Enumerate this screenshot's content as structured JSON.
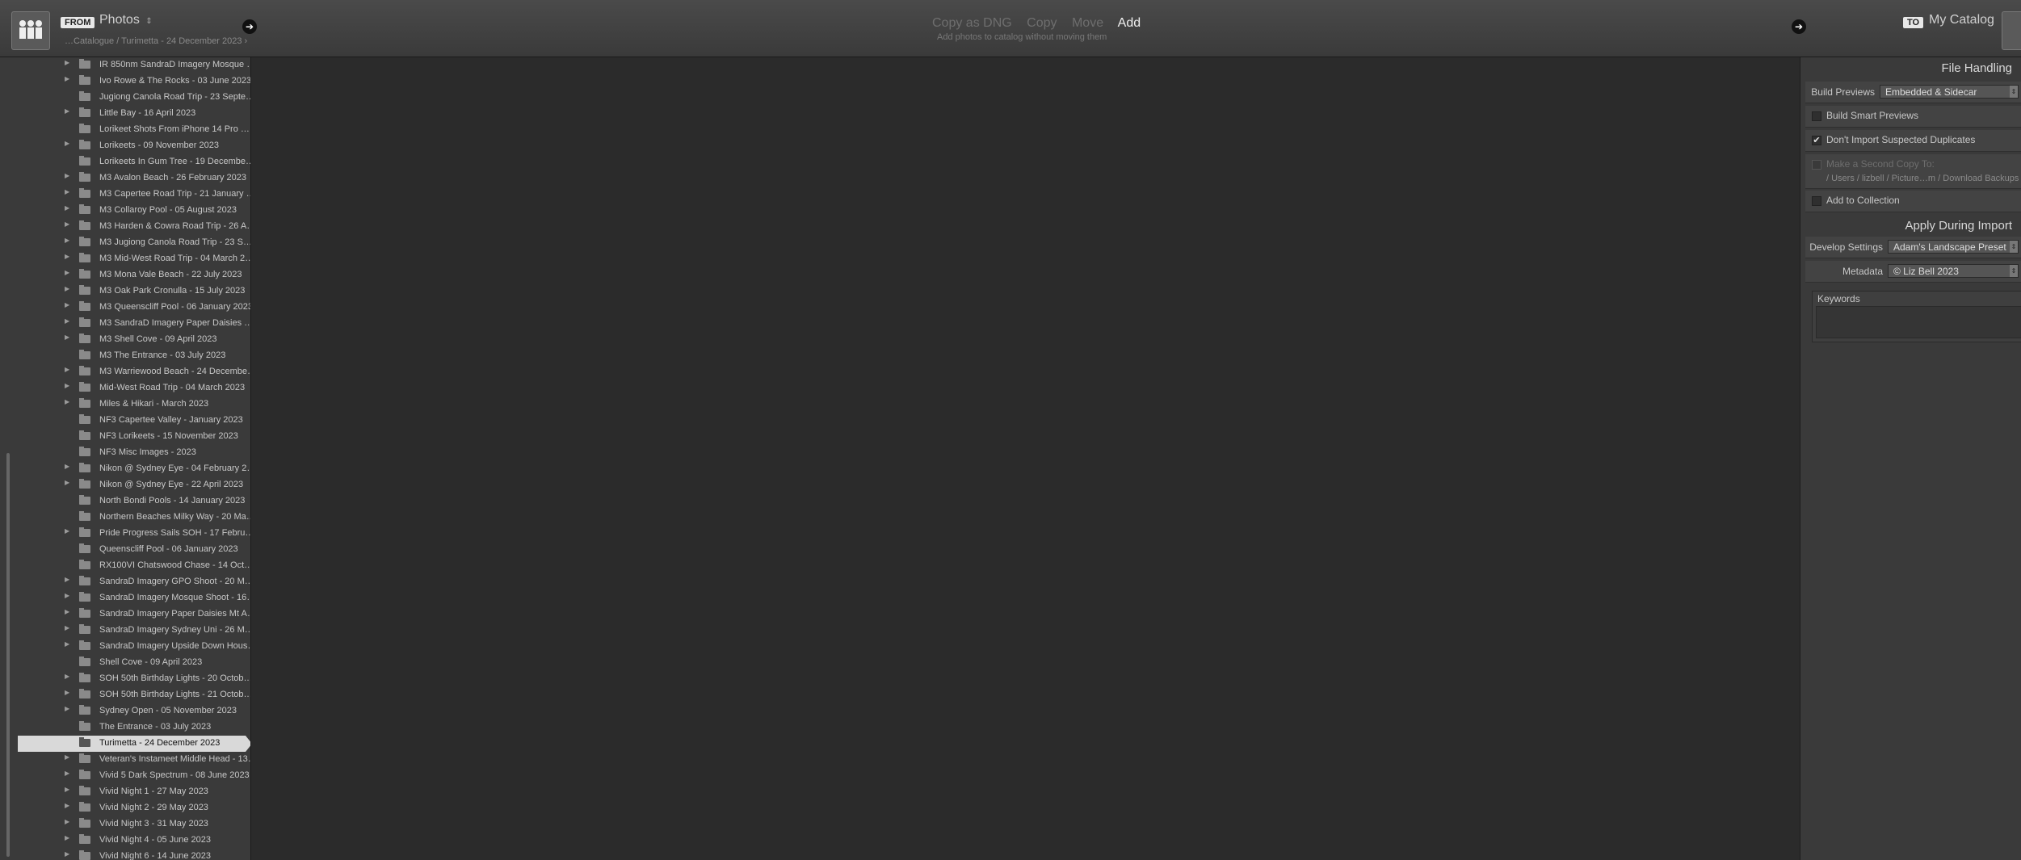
{
  "header": {
    "from_badge": "FROM",
    "source_name": "Photos",
    "source_chevron": "⇕",
    "source_path": "…Catalogue / Turimetta - 24 December 2023 ›",
    "modes": [
      "Copy as DNG",
      "Copy",
      "Move",
      "Add"
    ],
    "active_mode": "Add",
    "mode_description": "Add photos to catalog without moving them",
    "to_badge": "TO",
    "destination_name": "My Catalog",
    "arrow_glyph": "➔"
  },
  "folders": [
    {
      "label": "IR 850nm SandraD Imagery Mosque S…",
      "expandable": true,
      "selected": false
    },
    {
      "label": "Ivo Rowe & The Rocks - 03 June 2023",
      "expandable": true,
      "selected": false
    },
    {
      "label": "Jugiong Canola Road Trip - 23 Septemb…",
      "expandable": false,
      "selected": false
    },
    {
      "label": "Little Bay - 16 April 2023",
      "expandable": true,
      "selected": false
    },
    {
      "label": "Lorikeet Shots From iPhone 14 Pro Max…",
      "expandable": false,
      "selected": false
    },
    {
      "label": "Lorikeets - 09 November 2023",
      "expandable": true,
      "selected": false
    },
    {
      "label": "Lorikeets In Gum Tree - 19 December 2…",
      "expandable": false,
      "selected": false
    },
    {
      "label": "M3 Avalon Beach - 26 February 2023",
      "expandable": true,
      "selected": false
    },
    {
      "label": "M3 Capertee Road Trip - 21 January 2023",
      "expandable": true,
      "selected": false
    },
    {
      "label": "M3 Collaroy Pool - 05 August 2023",
      "expandable": true,
      "selected": false
    },
    {
      "label": "M3 Harden & Cowra Road Trip - 26 Aug…",
      "expandable": true,
      "selected": false
    },
    {
      "label": "M3 Jugiong Canola Road Trip - 23 Septe…",
      "expandable": true,
      "selected": false
    },
    {
      "label": "M3 Mid-West Road Trip - 04 March 2023",
      "expandable": true,
      "selected": false
    },
    {
      "label": "M3 Mona Vale Beach - 22 July 2023",
      "expandable": true,
      "selected": false
    },
    {
      "label": "M3 Oak Park Cronulla - 15 July 2023",
      "expandable": true,
      "selected": false
    },
    {
      "label": "M3 Queenscliff Pool - 06 January 2023",
      "expandable": true,
      "selected": false
    },
    {
      "label": "M3 SandraD Imagery Paper Daisies Mt…",
      "expandable": true,
      "selected": false
    },
    {
      "label": "M3 Shell Cove - 09 April 2023",
      "expandable": true,
      "selected": false
    },
    {
      "label": "M3 The Entrance - 03 July 2023",
      "expandable": false,
      "selected": false
    },
    {
      "label": "M3 Warriewood Beach - 24 December…",
      "expandable": true,
      "selected": false
    },
    {
      "label": "Mid-West Road Trip - 04 March 2023",
      "expandable": true,
      "selected": false
    },
    {
      "label": "Miles & Hikari - March 2023",
      "expandable": true,
      "selected": false
    },
    {
      "label": "NF3 Capertee Valley - January 2023",
      "expandable": false,
      "selected": false
    },
    {
      "label": "NF3 Lorikeets - 15 November 2023",
      "expandable": false,
      "selected": false
    },
    {
      "label": "NF3 Misc Images - 2023",
      "expandable": false,
      "selected": false
    },
    {
      "label": "Nikon @ Sydney Eye - 04 February 2023",
      "expandable": true,
      "selected": false
    },
    {
      "label": "Nikon @ Sydney Eye - 22 April 2023",
      "expandable": true,
      "selected": false
    },
    {
      "label": "North Bondi Pools - 14 January 2023",
      "expandable": false,
      "selected": false
    },
    {
      "label": "Northern Beaches Milky Way - 20 May…",
      "expandable": false,
      "selected": false
    },
    {
      "label": "Pride Progress Sails SOH - 17 February 2…",
      "expandable": true,
      "selected": false
    },
    {
      "label": "Queenscliff Pool - 06 January 2023",
      "expandable": false,
      "selected": false
    },
    {
      "label": "RX100VI Chatswood Chase - 14 October…",
      "expandable": false,
      "selected": false
    },
    {
      "label": "SandraD Imagery GPO Shoot - 20 May…",
      "expandable": true,
      "selected": false
    },
    {
      "label": "SandraD Imagery Mosque Shoot - 16 S…",
      "expandable": true,
      "selected": false
    },
    {
      "label": "SandraD Imagery Paper Daisies Mt Ann…",
      "expandable": true,
      "selected": false
    },
    {
      "label": "SandraD Imagery Sydney Uni - 26 Marc…",
      "expandable": true,
      "selected": false
    },
    {
      "label": "SandraD Imagery Upside Down House…",
      "expandable": true,
      "selected": false
    },
    {
      "label": "Shell Cove - 09 April 2023",
      "expandable": false,
      "selected": false
    },
    {
      "label": "SOH 50th Birthday Lights - 20 October…",
      "expandable": true,
      "selected": false
    },
    {
      "label": "SOH 50th Birthday Lights - 21 October…",
      "expandable": true,
      "selected": false
    },
    {
      "label": "Sydney Open - 05 November 2023",
      "expandable": true,
      "selected": false
    },
    {
      "label": "The Entrance - 03 July 2023",
      "expandable": false,
      "selected": false
    },
    {
      "label": "Turimetta - 24 December 2023",
      "expandable": false,
      "selected": true
    },
    {
      "label": "Veteran's Instameet Middle Head - 13…",
      "expandable": true,
      "selected": false
    },
    {
      "label": "Vivid 5 Dark Spectrum - 08 June 2023",
      "expandable": true,
      "selected": false
    },
    {
      "label": "Vivid Night 1 - 27 May 2023",
      "expandable": true,
      "selected": false
    },
    {
      "label": "Vivid Night 2 - 29 May 2023",
      "expandable": true,
      "selected": false
    },
    {
      "label": "Vivid Night 3 - 31 May 2023",
      "expandable": true,
      "selected": false
    },
    {
      "label": "Vivid Night 4 - 05 June 2023",
      "expandable": true,
      "selected": false
    },
    {
      "label": "Vivid Night 6 - 14 June 2023",
      "expandable": true,
      "selected": false
    }
  ],
  "file_handling": {
    "title": "File Handling",
    "build_previews_label": "Build Previews",
    "build_previews_value": "Embedded & Sidecar",
    "smart_previews_label": "Build Smart Previews",
    "smart_previews_checked": false,
    "duplicates_label": "Don't Import Suspected Duplicates",
    "duplicates_checked": true,
    "second_copy_label": "Make a Second Copy To:",
    "second_copy_path": "/ Users / lizbell / Picture…m / Download Backups",
    "add_collection_label": "Add to Collection",
    "checkmark": "✔",
    "dropdown_glyph": "⇕"
  },
  "apply_during_import": {
    "title": "Apply During Import",
    "develop_label": "Develop Settings",
    "develop_value": "Adam's Landscape Preset",
    "metadata_label": "Metadata",
    "metadata_value": "© Liz Bell 2023",
    "keywords_label": "Keywords"
  }
}
